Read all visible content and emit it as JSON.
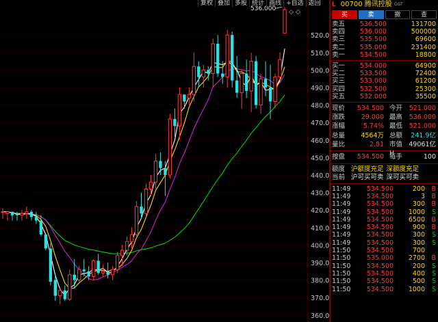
{
  "toolbar": [
    "复权",
    "叠加",
    "多股",
    "统计",
    "画线",
    "+自选",
    "返回"
  ],
  "header": {
    "marker": "L",
    "code": "00700",
    "name": "腾讯控股",
    "tag": "GGT"
  },
  "buttons": {
    "buy": "买",
    "sell": "卖",
    "cancel": "撤",
    "more": "查"
  },
  "asks": [
    {
      "label": "卖五",
      "price": "536.500",
      "vol": "131700"
    },
    {
      "label": "卖四",
      "price": "536.000",
      "vol": "500000"
    },
    {
      "label": "卖三",
      "price": "535.500",
      "vol": "69600"
    },
    {
      "label": "卖二",
      "price": "535.000",
      "vol": "231400"
    },
    {
      "label": "卖一",
      "price": "534.500",
      "vol": "18800"
    }
  ],
  "bids": [
    {
      "label": "买一",
      "price": "534.000",
      "vol": "64900"
    },
    {
      "label": "买二",
      "price": "533.500",
      "vol": "72400"
    },
    {
      "label": "买三",
      "price": "533.000",
      "vol": "61200"
    },
    {
      "label": "买四",
      "price": "532.500",
      "vol": "25300"
    },
    {
      "label": "买五",
      "price": "532.000",
      "vol": "35500"
    }
  ],
  "stats": [
    {
      "l1": "现价",
      "v1": "534.500",
      "c1": "red",
      "l2": "今开",
      "v2": "521.000",
      "c2": "red"
    },
    {
      "l1": "涨跌",
      "v1": "29.000",
      "c1": "red",
      "l2": "最高",
      "v2": "536.000",
      "c2": "red"
    },
    {
      "l1": "涨幅",
      "v1": "5.74%",
      "c1": "red",
      "l2": "最低",
      "v2": "521.000",
      "c2": "red"
    },
    {
      "l1": "总量",
      "v1": "4564万",
      "c1": "yel",
      "l2": "总额",
      "v2": "241.9亿",
      "c2": "cyan"
    },
    {
      "l1": "量比",
      "v1": "2.81",
      "c1": "red",
      "l2": "市值H",
      "v2": "49061亿",
      "c2": "wh"
    }
  ],
  "closing": {
    "l1": "按盘",
    "v1": "534.500",
    "l2": "每手",
    "v2": "100"
  },
  "quota": {
    "l1": "额度",
    "a1": "沪额度充足",
    "b1": "深额度充足",
    "l2": "当前",
    "a2": "沪可买可卖",
    "b2": "深可买可卖"
  },
  "ticks": [
    {
      "t": "11:49",
      "p": "534.500",
      "v": "200",
      "s": "B"
    },
    {
      "t": "11:49",
      "p": "534.500",
      "v": "3",
      "s": "B"
    },
    {
      "t": "11:49",
      "p": "534.500",
      "v": "300",
      "s": "B"
    },
    {
      "t": "11:49",
      "p": "534.500",
      "v": "1000",
      "s": "S"
    },
    {
      "t": "11:49",
      "p": "534.500",
      "v": "6500",
      "s": "B"
    },
    {
      "t": "11:49",
      "p": "534.500",
      "v": "900",
      "s": "B"
    },
    {
      "t": "11:49",
      "p": "534.500",
      "v": "300",
      "s": "S"
    },
    {
      "t": "11:49",
      "p": "534.500",
      "v": "300",
      "s": "S"
    },
    {
      "t": "11:50",
      "p": "534.500",
      "v": "700",
      "s": ""
    },
    {
      "t": "11:50",
      "p": "535.000",
      "v": "2700",
      "s": "B"
    },
    {
      "t": "11:50",
      "p": "534.500",
      "v": "200",
      "s": "S"
    },
    {
      "t": "11:50",
      "p": "534.500",
      "v": "400",
      "s": "S"
    },
    {
      "t": "11:50",
      "p": "534.500",
      "v": "500",
      "s": "S"
    },
    {
      "t": "11:50",
      "p": "534.500",
      "v": "1000",
      "s": "S"
    }
  ],
  "colors": {
    "up": "#ff3b3b",
    "down": "#2fe0e0",
    "ma5": "#ffffff",
    "ma10": "#ffd800",
    "ma20": "#d020d0",
    "ma60": "#00d000",
    "grid": "#5a0000"
  },
  "chart_data": {
    "type": "candlestick",
    "y_ticks": [
      360,
      370,
      380,
      390,
      400,
      410,
      420,
      430,
      440,
      450,
      460,
      470,
      480,
      490,
      500,
      510,
      520
    ],
    "ylim": [
      356,
      540
    ],
    "max_label": "536.000",
    "candles": [
      [
        419,
        421,
        415,
        419
      ],
      [
        418,
        419,
        414,
        419
      ],
      [
        419,
        419,
        414,
        417
      ],
      [
        418,
        419,
        414,
        417
      ],
      [
        417,
        420,
        414,
        418
      ],
      [
        418,
        422,
        415,
        419
      ],
      [
        419,
        420,
        414,
        416
      ],
      [
        416,
        419,
        412,
        414
      ],
      [
        414,
        417,
        405,
        406
      ],
      [
        406,
        406,
        397,
        398
      ],
      [
        398,
        401,
        377,
        379
      ],
      [
        380,
        383,
        368,
        371
      ],
      [
        371,
        376,
        366,
        374
      ],
      [
        374,
        377,
        368,
        369
      ],
      [
        369,
        386,
        368,
        383
      ],
      [
        383,
        392,
        375,
        380
      ],
      [
        380,
        388,
        378,
        386
      ],
      [
        386,
        392,
        382,
        385
      ],
      [
        385,
        388,
        380,
        382
      ],
      [
        382,
        392,
        380,
        391
      ],
      [
        391,
        395,
        383,
        384
      ],
      [
        384,
        389,
        382,
        385
      ],
      [
        385,
        390,
        381,
        383
      ],
      [
        383,
        388,
        380,
        386
      ],
      [
        386,
        396,
        384,
        394
      ],
      [
        394,
        400,
        388,
        397
      ],
      [
        397,
        405,
        394,
        402
      ],
      [
        402,
        410,
        398,
        406
      ],
      [
        406,
        425,
        405,
        422
      ],
      [
        422,
        430,
        415,
        418
      ],
      [
        418,
        435,
        416,
        432
      ],
      [
        432,
        440,
        428,
        436
      ],
      [
        436,
        452,
        432,
        448
      ],
      [
        448,
        453,
        440,
        444
      ],
      [
        444,
        448,
        428,
        440
      ],
      [
        440,
        475,
        438,
        472
      ],
      [
        472,
        478,
        462,
        468
      ],
      [
        468,
        490,
        460,
        486
      ],
      [
        486,
        482,
        478,
        482
      ],
      [
        484,
        490,
        480,
        486
      ],
      [
        486,
        510,
        482,
        502
      ],
      [
        502,
        505,
        490,
        496
      ],
      [
        496,
        503,
        490,
        500
      ],
      [
        500,
        502,
        494,
        498
      ],
      [
        498,
        518,
        490,
        515
      ],
      [
        515,
        520,
        496,
        498
      ],
      [
        498,
        505,
        492,
        496
      ],
      [
        496,
        523,
        490,
        520
      ],
      [
        520,
        522,
        490,
        494
      ],
      [
        494,
        508,
        484,
        487
      ],
      [
        487,
        500,
        478,
        498
      ],
      [
        498,
        506,
        484,
        488
      ],
      [
        488,
        510,
        476,
        505
      ],
      [
        505,
        508,
        478,
        480
      ],
      [
        480,
        498,
        475,
        495
      ],
      [
        495,
        505,
        485,
        490
      ],
      [
        490,
        503,
        472,
        482
      ],
      [
        482,
        498,
        478,
        496
      ],
      [
        496,
        510,
        494,
        506
      ],
      [
        521,
        536,
        521,
        534.5
      ]
    ],
    "ma5": [],
    "ma10": [],
    "ma20": [],
    "ma60": []
  }
}
